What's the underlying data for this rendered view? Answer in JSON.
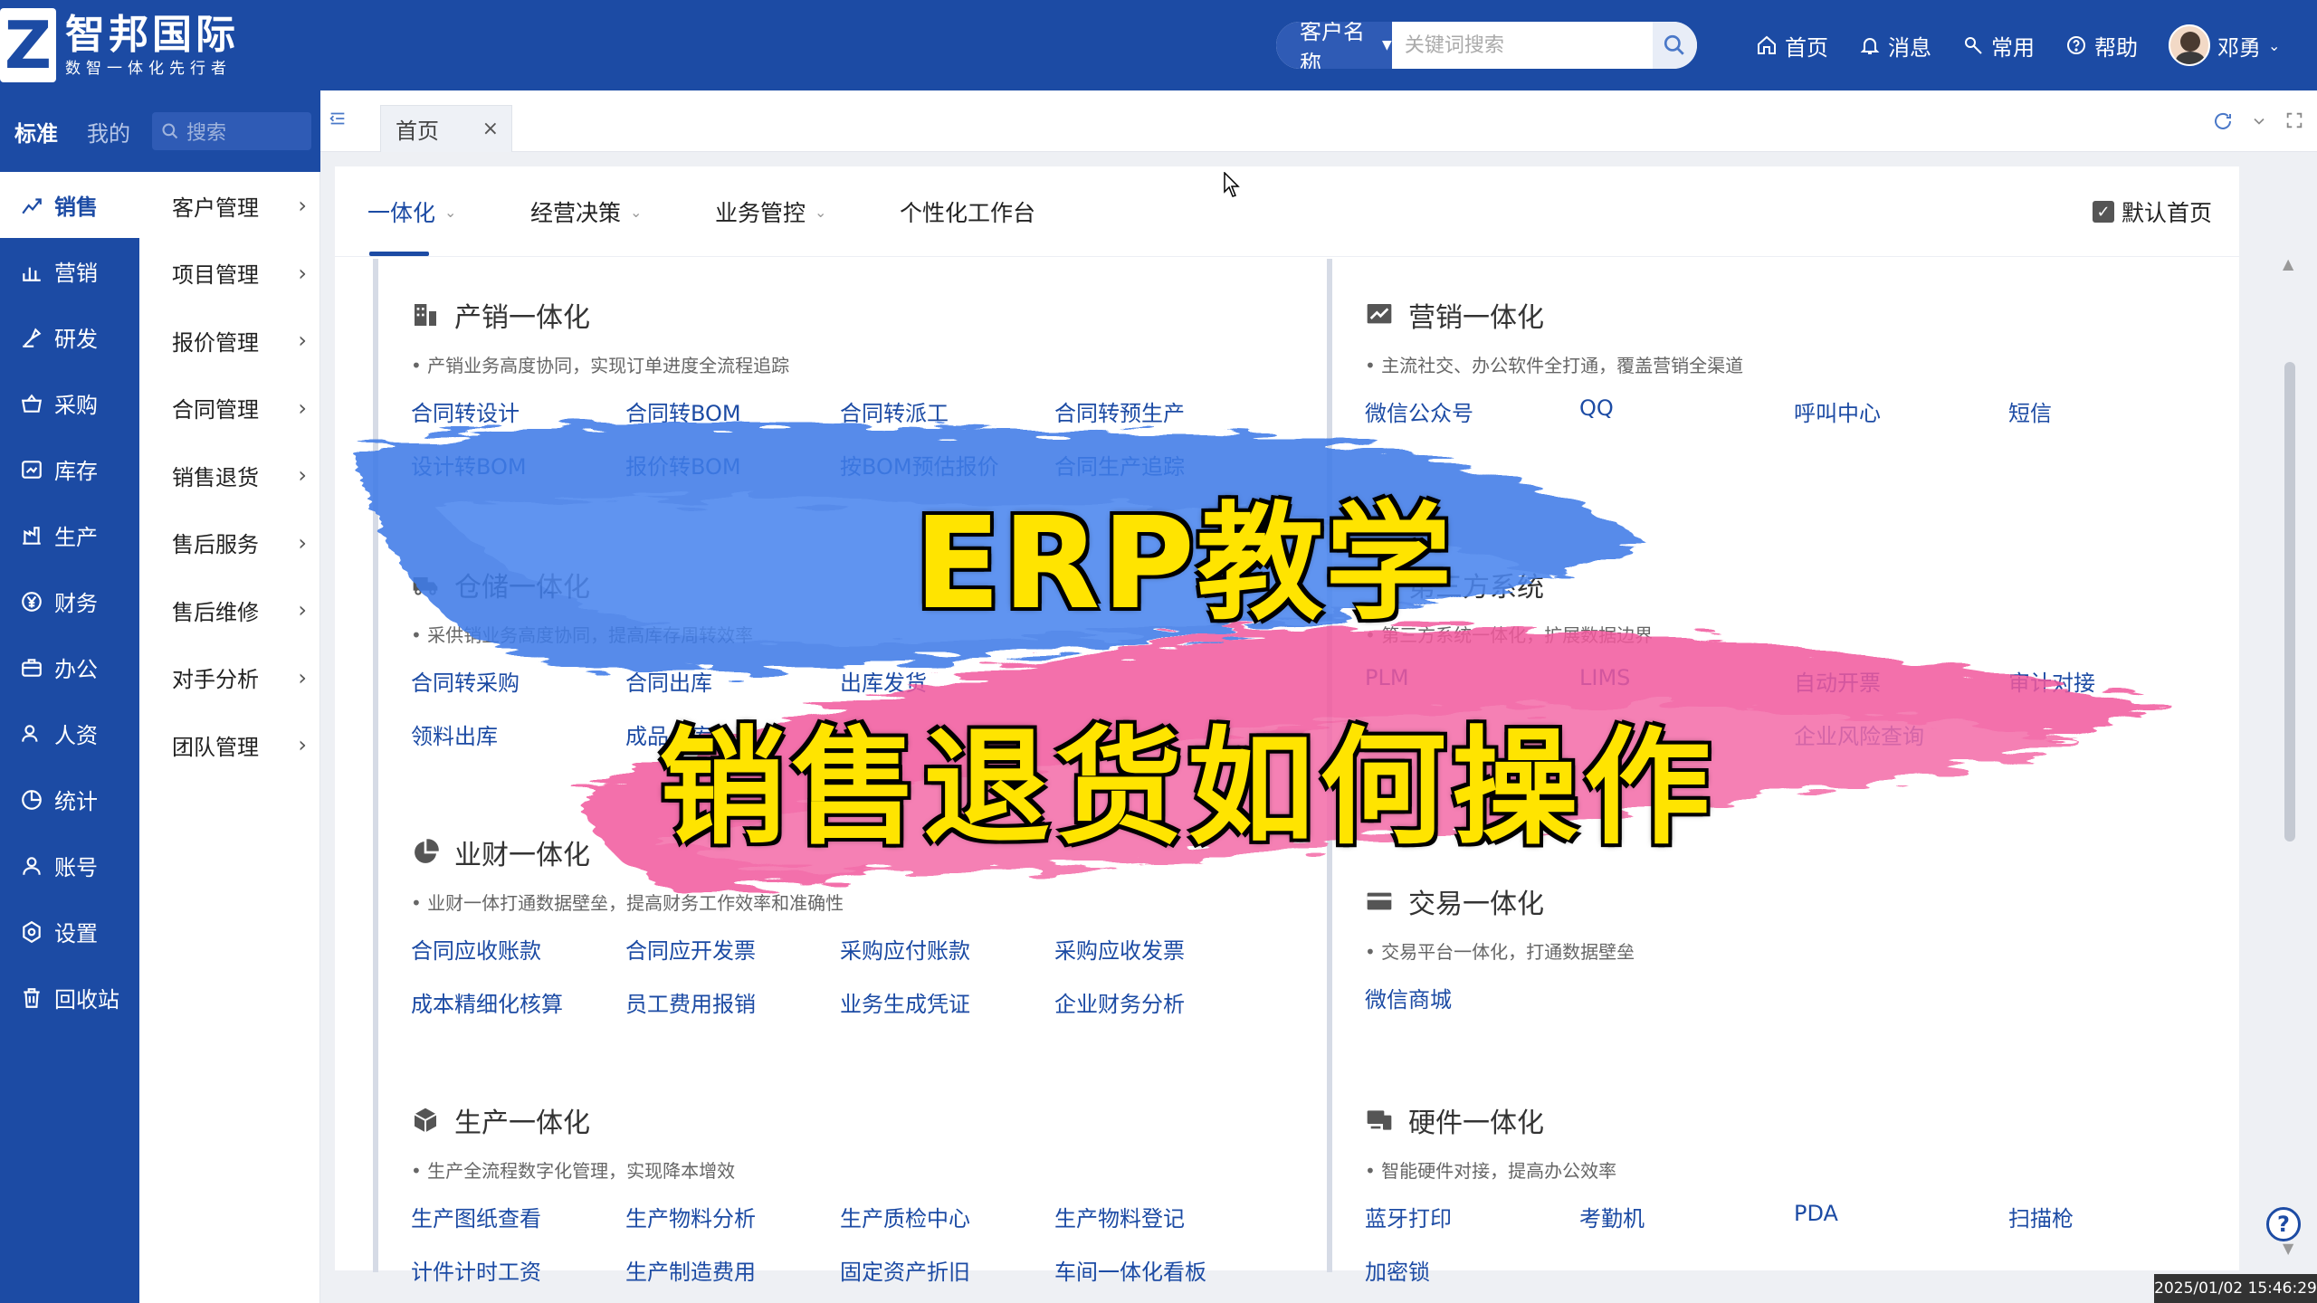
{
  "app": {
    "brand_mark": "Z",
    "brand_name": "智邦国际",
    "brand_slogan": "数智一体化先行者"
  },
  "header": {
    "search_type": "客户名称",
    "search_placeholder": "关键词搜索",
    "nav": [
      {
        "label": "首页",
        "icon": "home-icon"
      },
      {
        "label": "消息",
        "icon": "bell-icon"
      },
      {
        "label": "常用",
        "icon": "tool-icon"
      },
      {
        "label": "帮助",
        "icon": "help-icon"
      }
    ],
    "user_name": "邓勇"
  },
  "rail": {
    "tab_standard": "标准",
    "tab_mine": "我的",
    "search_placeholder": "搜索"
  },
  "sidebar": {
    "modules": [
      {
        "label": "销售",
        "icon": "sales-chart-icon"
      },
      {
        "label": "营销",
        "icon": "bar-chart-icon"
      },
      {
        "label": "研发",
        "icon": "research-icon"
      },
      {
        "label": "采购",
        "icon": "basket-icon"
      },
      {
        "label": "库存",
        "icon": "inventory-icon"
      },
      {
        "label": "生产",
        "icon": "production-icon"
      },
      {
        "label": "财务",
        "icon": "yen-icon"
      },
      {
        "label": "办公",
        "icon": "briefcase-icon"
      },
      {
        "label": "人资",
        "icon": "person-group-icon"
      },
      {
        "label": "统计",
        "icon": "pie-icon"
      },
      {
        "label": "账号",
        "icon": "user-icon"
      },
      {
        "label": "设置",
        "icon": "settings-icon"
      },
      {
        "label": "回收站",
        "icon": "trash-icon"
      }
    ],
    "submenu": [
      "客户管理",
      "项目管理",
      "报价管理",
      "合同管理",
      "销售退货",
      "售后服务",
      "售后维修",
      "对手分析",
      "团队管理"
    ]
  },
  "tabs": {
    "open": [
      {
        "label": "首页"
      }
    ]
  },
  "content": {
    "subnav": [
      {
        "label": "一体化",
        "active": true
      },
      {
        "label": "经营决策"
      },
      {
        "label": "业务管控"
      },
      {
        "label": "个性化工作台"
      }
    ],
    "default_home_label": "默认首页",
    "sections": [
      {
        "title": "产销一体化",
        "desc": "• 产销业务高度协同，实现订单进度全流程追踪",
        "links": [
          "合同转设计",
          "合同转BOM",
          "合同转派工",
          "合同转预生产",
          "设计转BOM",
          "报价转BOM",
          "按BOM预估报价",
          "合同生产追踪"
        ]
      },
      {
        "title": "仓储一体化",
        "desc": "• 采供销业务高度协同，提高库存周转效率",
        "links": [
          "合同转采购",
          "合同出库",
          "出库发货",
          "",
          "领料出库",
          "成品入库"
        ]
      },
      {
        "title": "业财一体化",
        "desc": "• 业财一体打通数据壁垒，提高财务工作效率和准确性",
        "links": [
          "合同应收账款",
          "合同应开发票",
          "采购应付账款",
          "采购应收发票",
          "成本精细化核算",
          "员工费用报销",
          "业务生成凭证",
          "企业财务分析"
        ]
      },
      {
        "title": "生产一体化",
        "desc": "• 生产全流程数字化管理，实现降本增效",
        "links": [
          "生产图纸查看",
          "生产物料分析",
          "生产质检中心",
          "生产物料登记",
          "计件计时工资",
          "生产制造费用",
          "固定资产折旧",
          "车间一体化看板"
        ]
      },
      {
        "title": "营销一体化",
        "desc": "• 主流社交、办公软件全打通，覆盖营销全渠道",
        "links": [
          "微信公众号",
          "QQ",
          "呼叫中心",
          "短信"
        ]
      },
      {
        "title": "第三方系统",
        "desc": "• 第三方系统一体化，扩展数据边界",
        "links": [
          "PLM",
          "LIMS",
          "自动开票",
          "审计对接",
          "",
          "",
          "企业风险查询"
        ]
      },
      {
        "title": "交易一体化",
        "desc": "• 交易平台一体化，打通数据壁垒",
        "links": [
          "微信商城"
        ]
      },
      {
        "title": "硬件一体化",
        "desc": "• 智能硬件对接，提高办公效率",
        "links": [
          "蓝牙打印",
          "考勤机",
          "PDA",
          "扫描枪",
          "加密锁"
        ]
      }
    ]
  },
  "overlay": {
    "title": "ERP教学",
    "subtitle": "销售退货如何操作"
  },
  "status": {
    "timestamp": "2025/01/02 15:46:29"
  },
  "colors": {
    "primary": "#1c4ba4",
    "overlay_text": "#ffe400",
    "brush_blue": "#3f7be8",
    "brush_pink": "#f2589d"
  }
}
